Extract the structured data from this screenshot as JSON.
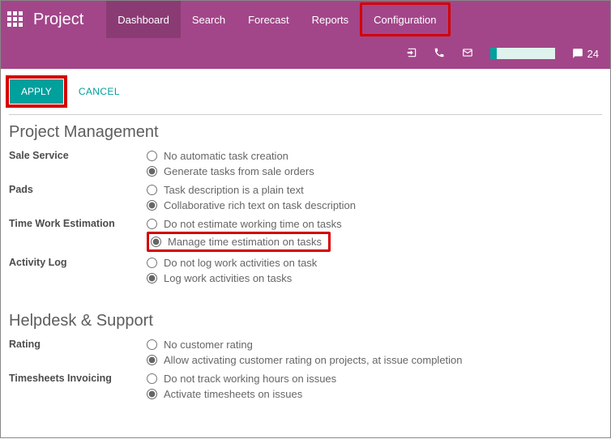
{
  "header": {
    "brand": "Project",
    "nav": [
      "Dashboard",
      "Search",
      "Forecast",
      "Reports",
      "Configuration"
    ],
    "active_nav_index": 0,
    "highlighted_nav_index": 4
  },
  "systray": {
    "messages_count": "24"
  },
  "actions": {
    "apply": "APPLY",
    "cancel": "CANCEL"
  },
  "sections": [
    {
      "title": "Project Management",
      "fields": [
        {
          "label": "Sale Service",
          "options": [
            "No automatic task creation",
            "Generate tasks from sale orders"
          ],
          "selected": 1
        },
        {
          "label": "Pads",
          "options": [
            "Task description is a plain text",
            "Collaborative rich text on task description"
          ],
          "selected": 1
        },
        {
          "label": "Time Work Estimation",
          "options": [
            "Do not estimate working time on tasks",
            "Manage time estimation on tasks"
          ],
          "selected": 1,
          "highlight_option": 1
        },
        {
          "label": "Activity Log",
          "options": [
            "Do not log work activities on task",
            "Log work activities on tasks"
          ],
          "selected": 1
        }
      ]
    },
    {
      "title": "Helpdesk & Support",
      "fields": [
        {
          "label": "Rating",
          "options": [
            "No customer rating",
            "Allow activating customer rating on projects, at issue completion"
          ],
          "selected": 1
        },
        {
          "label": "Timesheets Invoicing",
          "options": [
            "Do not track working hours on issues",
            "Activate timesheets on issues"
          ],
          "selected": 1
        }
      ]
    }
  ]
}
